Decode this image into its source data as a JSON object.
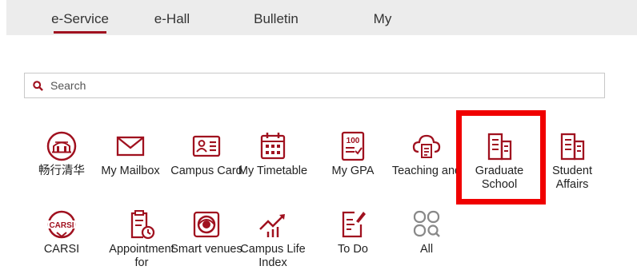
{
  "tabs": [
    {
      "label": "e-Service",
      "active": true
    },
    {
      "label": "e-Hall",
      "active": false
    },
    {
      "label": "Bulletin",
      "active": false
    },
    {
      "label": "My",
      "active": false
    }
  ],
  "search": {
    "placeholder": "Search"
  },
  "apps": {
    "row1": [
      {
        "label": "畅行清华",
        "icon": "tsinghua-gate-icon"
      },
      {
        "label": "My Mailbox",
        "icon": "envelope-icon"
      },
      {
        "label": "Campus Card",
        "icon": "id-card-icon"
      },
      {
        "label": "My Timetable",
        "icon": "calendar-icon"
      },
      {
        "label": "My GPA",
        "icon": "gpa-report-icon"
      },
      {
        "label": "Teaching and",
        "icon": "cloud-document-icon"
      },
      {
        "label": "Graduate School",
        "icon": "building-icon",
        "highlighted": true
      },
      {
        "label": "Student Affairs",
        "icon": "building-icon"
      }
    ],
    "row2": [
      {
        "label": "CARSI",
        "icon": "carsi-logo-icon"
      },
      {
        "label": "Appointment for",
        "icon": "clipboard-clock-icon"
      },
      {
        "label": "Smart venues",
        "icon": "venue-circle-icon"
      },
      {
        "label": "Campus Life Index",
        "icon": "trend-chart-icon"
      },
      {
        "label": "To Do",
        "icon": "todo-note-icon"
      },
      {
        "label": "All",
        "icon": "grid-search-icon"
      }
    ]
  },
  "colors": {
    "accent": "#a0111f",
    "highlight": "#f00000",
    "tabbar": "#ececec"
  }
}
